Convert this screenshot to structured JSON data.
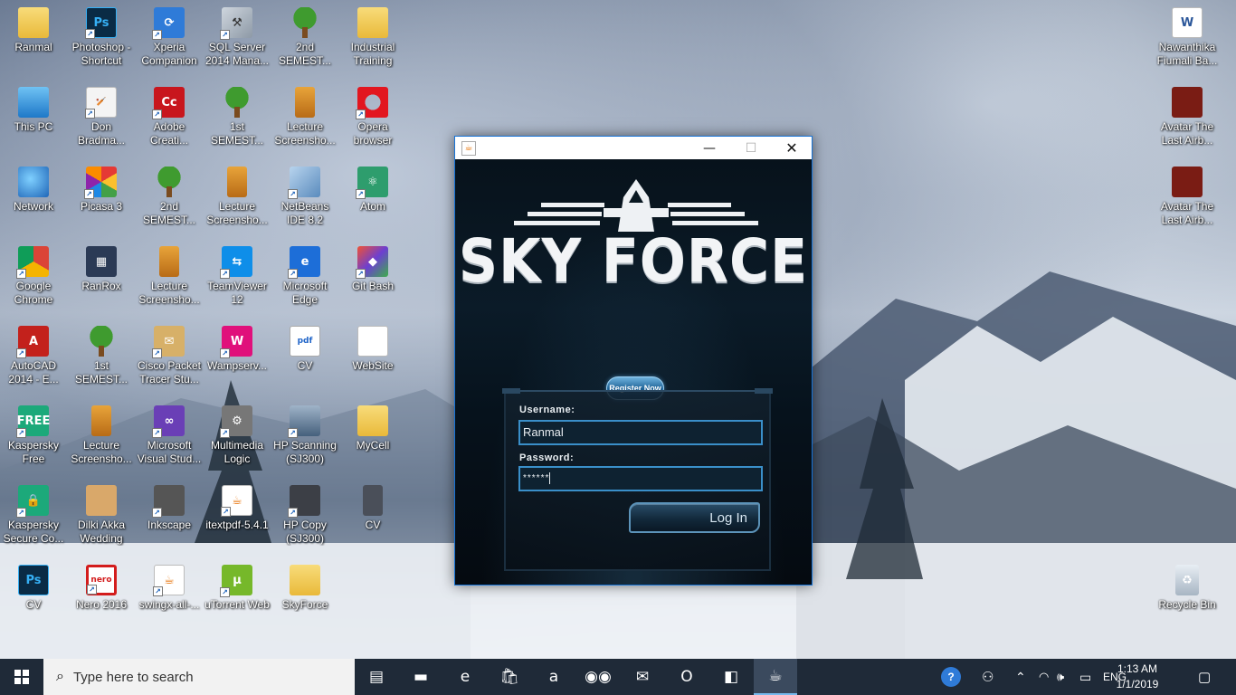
{
  "desktop": {
    "icons": [
      {
        "id": "ranmal",
        "label": "Ranmal",
        "glyph": "",
        "icon": "folder-user-icon",
        "style": "g-folder",
        "shortcut": false
      },
      {
        "id": "photoshop",
        "label": "Photoshop - Shortcut",
        "glyph": "Ps",
        "icon": "photoshop-icon",
        "style": "g-ps",
        "shortcut": true
      },
      {
        "id": "xperia",
        "label": "Xperia Companion",
        "glyph": "⟳",
        "icon": "xperia-companion-icon",
        "style": "g-blue",
        "shortcut": true
      },
      {
        "id": "sqlserver",
        "label": "SQL Server 2014 Mana...",
        "glyph": "⚒",
        "icon": "sql-server-icon",
        "style": "g-sql",
        "shortcut": true
      },
      {
        "id": "2ndsem1",
        "label": "2nd SEMEST...",
        "glyph": "",
        "icon": "tree-icon",
        "style": "g-tree",
        "shortcut": false
      },
      {
        "id": "industrial",
        "label": "Industrial Training",
        "glyph": "",
        "icon": "folder-icon",
        "style": "g-folder",
        "shortcut": false
      },
      {
        "id": "thispc",
        "label": "This PC",
        "glyph": "",
        "icon": "computer-icon",
        "style": "g-pc",
        "shortcut": false
      },
      {
        "id": "don",
        "label": "Don Bradma...",
        "glyph": "🏏",
        "icon": "cricket-icon",
        "style": "g-doc",
        "shortcut": true
      },
      {
        "id": "adobe",
        "label": "Adobe Creati...",
        "glyph": "Cc",
        "icon": "adobe-cc-icon",
        "style": "g-red",
        "shortcut": true
      },
      {
        "id": "1stsem1",
        "label": "1st SEMEST...",
        "glyph": "",
        "icon": "tree-icon",
        "style": "g-tree",
        "shortcut": false
      },
      {
        "id": "lecture1",
        "label": "Lecture Screensho...",
        "glyph": "",
        "icon": "phone-icon",
        "style": "g-phone",
        "shortcut": false
      },
      {
        "id": "opera",
        "label": "Opera browser",
        "glyph": "",
        "icon": "opera-icon",
        "style": "g-opera",
        "shortcut": true
      },
      {
        "id": "network",
        "label": "Network",
        "glyph": "",
        "icon": "network-icon",
        "style": "g-net",
        "shortcut": false
      },
      {
        "id": "picasa",
        "label": "Picasa 3",
        "glyph": "",
        "icon": "picasa-icon",
        "style": "g-picasa",
        "shortcut": true
      },
      {
        "id": "2ndsem2",
        "label": "2nd SEMEST...",
        "glyph": "",
        "icon": "tree-icon",
        "style": "g-tree",
        "shortcut": false
      },
      {
        "id": "lecture2",
        "label": "Lecture Screensho...",
        "glyph": "",
        "icon": "phone-icon",
        "style": "g-phone",
        "shortcut": false
      },
      {
        "id": "netbeans",
        "label": "NetBeans IDE 8.2",
        "glyph": "",
        "icon": "netbeans-icon",
        "style": "g-cube",
        "shortcut": true
      },
      {
        "id": "atom",
        "label": "Atom",
        "glyph": "⚛",
        "icon": "atom-icon",
        "style": "g-atom",
        "shortcut": true
      },
      {
        "id": "chrome",
        "label": "Google Chrome",
        "glyph": "",
        "icon": "chrome-icon",
        "style": "g-chrome",
        "shortcut": true
      },
      {
        "id": "ranrox",
        "label": "RanRox",
        "glyph": "▦",
        "icon": "film-icon",
        "style": "g-film",
        "shortcut": false
      },
      {
        "id": "lecture3",
        "label": "Lecture Screensho...",
        "glyph": "",
        "icon": "phone-icon",
        "style": "g-phone",
        "shortcut": false
      },
      {
        "id": "teamviewer",
        "label": "TeamViewer 12",
        "glyph": "⇆",
        "icon": "teamviewer-icon",
        "style": "g-tv",
        "shortcut": true
      },
      {
        "id": "edge",
        "label": "Microsoft Edge",
        "glyph": "e",
        "icon": "edge-icon",
        "style": "g-edge",
        "shortcut": true
      },
      {
        "id": "gitbash",
        "label": "Git Bash",
        "glyph": "◆",
        "icon": "git-icon",
        "style": "g-git",
        "shortcut": true
      },
      {
        "id": "autocad",
        "label": "AutoCAD 2014 - E...",
        "glyph": "A",
        "icon": "autocad-icon",
        "style": "g-acad",
        "shortcut": true
      },
      {
        "id": "1stsem2",
        "label": "1st SEMEST...",
        "glyph": "",
        "icon": "tree-icon",
        "style": "g-tree",
        "shortcut": false
      },
      {
        "id": "cisco",
        "label": "Cisco Packet Tracer Stu...",
        "glyph": "✉",
        "icon": "cisco-packet-tracer-icon",
        "style": "g-cisco",
        "shortcut": true
      },
      {
        "id": "wamp",
        "label": "Wampserv...",
        "glyph": "W",
        "icon": "wampserver-icon",
        "style": "g-wamp",
        "shortcut": true
      },
      {
        "id": "cvpdf",
        "label": "CV",
        "glyph": "pdf",
        "icon": "pdf-icon",
        "style": "g-pdf",
        "shortcut": false
      },
      {
        "id": "website",
        "label": "WebSite",
        "glyph": "",
        "icon": "document-icon",
        "style": "g-web",
        "shortcut": false
      },
      {
        "id": "kasfree",
        "label": "Kaspersky Free",
        "glyph": "FREE",
        "icon": "kaspersky-free-icon",
        "style": "g-kas",
        "shortcut": true
      },
      {
        "id": "lecture4",
        "label": "Lecture Screensho...",
        "glyph": "",
        "icon": "phone-icon",
        "style": "g-phone",
        "shortcut": false
      },
      {
        "id": "msvs",
        "label": "Microsoft Visual Stud...",
        "glyph": "∞",
        "icon": "visual-studio-icon",
        "style": "g-ms",
        "shortcut": true
      },
      {
        "id": "multimedia",
        "label": "Multimedia Logic",
        "glyph": "⚙",
        "icon": "multimedia-logic-icon",
        "style": "g-mm",
        "shortcut": true
      },
      {
        "id": "hpscan",
        "label": "HP Scanning (SJ300)",
        "glyph": "",
        "icon": "scanner-icon",
        "style": "g-scan",
        "shortcut": true
      },
      {
        "id": "mycell",
        "label": "MyCell",
        "glyph": "",
        "icon": "folder-icon",
        "style": "g-folder",
        "shortcut": false
      },
      {
        "id": "kassecure",
        "label": "Kaspersky Secure Co...",
        "glyph": "🔒",
        "icon": "kaspersky-secure-icon",
        "style": "g-kas",
        "shortcut": true
      },
      {
        "id": "dilki",
        "label": "Dilki Akka Wedding",
        "glyph": "",
        "icon": "people-icon",
        "style": "g-people",
        "shortcut": false
      },
      {
        "id": "inkscape",
        "label": "Inkscape",
        "glyph": "",
        "icon": "inkscape-icon",
        "style": "g-ink",
        "shortcut": true
      },
      {
        "id": "itextpdf",
        "label": "itextpdf-5.4.1",
        "glyph": "☕",
        "icon": "java-jar-icon",
        "style": "g-java",
        "shortcut": true
      },
      {
        "id": "hpcopy",
        "label": "HP Copy (SJ300)",
        "glyph": "",
        "icon": "copier-icon",
        "style": "g-copy",
        "shortcut": true
      },
      {
        "id": "cv2",
        "label": "CV",
        "glyph": "",
        "icon": "document-dark-icon",
        "style": "g-cv2",
        "shortcut": false
      },
      {
        "id": "cvpsd",
        "label": "CV",
        "glyph": "Ps",
        "icon": "psd-icon",
        "style": "g-ps",
        "shortcut": false
      },
      {
        "id": "nero",
        "label": "Nero 2016",
        "glyph": "nero",
        "icon": "nero-icon",
        "style": "g-nero",
        "shortcut": true
      },
      {
        "id": "swingx",
        "label": "swingx-all-...",
        "glyph": "☕",
        "icon": "java-jar-icon",
        "style": "g-java",
        "shortcut": true
      },
      {
        "id": "utorrent",
        "label": "uTorrent Web",
        "glyph": "µ",
        "icon": "utorrent-icon",
        "style": "g-ut",
        "shortcut": true
      },
      {
        "id": "skyforce",
        "label": "SkyForce",
        "glyph": "",
        "icon": "folder-icon",
        "style": "g-folder",
        "shortcut": false
      }
    ],
    "right_icons": [
      {
        "id": "nawanthika",
        "label": "Nawanthika Fiumali Ba...",
        "glyph": "W",
        "icon": "word-doc-icon",
        "style": "g-word",
        "shortcut": false
      },
      {
        "id": "avatar1",
        "label": "Avatar The Last Airb...",
        "glyph": "",
        "icon": "book-icon",
        "style": "g-book",
        "shortcut": false
      },
      {
        "id": "avatar2",
        "label": "Avatar The Last Airb...",
        "glyph": "",
        "icon": "book-icon",
        "style": "g-book",
        "shortcut": false
      },
      {
        "id": "recyclebin",
        "label": "Recycle Bin",
        "glyph": "♻",
        "icon": "recycle-bin-icon",
        "style": "g-bin",
        "shortcut": false
      }
    ]
  },
  "window": {
    "title_icon": "☕",
    "minimize": "—",
    "maximize": "☐",
    "close": "✕",
    "logo_text": "SKY FORCE",
    "register_label": "Register Now",
    "username_label": "Username:",
    "username_value": "Ranmal",
    "password_label": "Password:",
    "password_value": "******",
    "login_label": "Log In"
  },
  "taskbar": {
    "search_placeholder": "Type here to search",
    "apps": [
      {
        "id": "taskview",
        "glyph": "▤",
        "icon": "task-view-icon",
        "active": false
      },
      {
        "id": "explorer",
        "glyph": "▬",
        "icon": "file-explorer-icon",
        "active": false
      },
      {
        "id": "edge",
        "glyph": "e",
        "icon": "edge-icon",
        "active": false
      },
      {
        "id": "store",
        "glyph": "🛍",
        "icon": "store-icon",
        "active": false
      },
      {
        "id": "amazon",
        "glyph": "a",
        "icon": "amazon-icon",
        "active": false
      },
      {
        "id": "tripadvisor",
        "glyph": "◉◉",
        "icon": "tripadvisor-icon",
        "active": false
      },
      {
        "id": "mail",
        "glyph": "✉",
        "icon": "mail-icon",
        "active": false
      },
      {
        "id": "opera",
        "glyph": "O",
        "icon": "opera-icon",
        "active": false
      },
      {
        "id": "netbeans",
        "glyph": "◧",
        "icon": "netbeans-icon",
        "active": false
      },
      {
        "id": "java",
        "glyph": "☕",
        "icon": "java-icon",
        "active": true
      }
    ],
    "tray": {
      "help": "?",
      "people": "⚇",
      "chevron": "⌃",
      "wifi": "◠",
      "volume": "🕪",
      "battery": "▭",
      "language": "ENG",
      "time": "1:13 AM",
      "date": "1/1/2019",
      "notifications": "▢"
    }
  },
  "colors": {
    "accent": "#1773d6",
    "taskbar": "#1f2a38",
    "field_border": "#3a8fc9"
  }
}
